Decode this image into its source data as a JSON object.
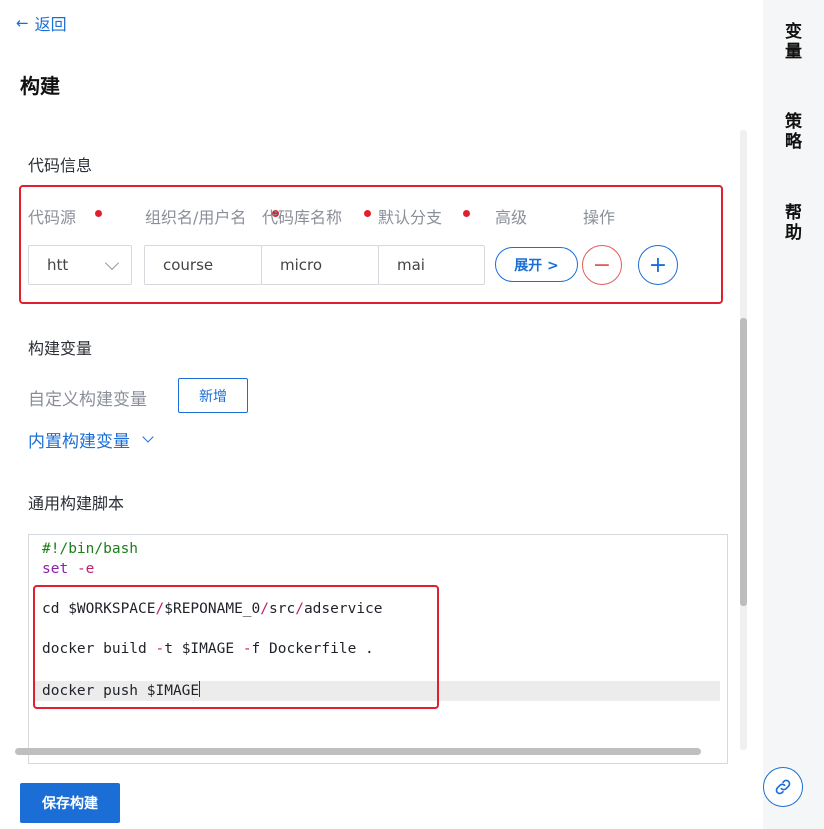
{
  "nav": {
    "back_label": "返回"
  },
  "page": {
    "title": "构建"
  },
  "code_info": {
    "section_title": "代码信息",
    "headers": {
      "source": "代码源",
      "org": "组织名/用户名",
      "repo": "代码库名称",
      "branch": "默认分支",
      "advanced": "高级",
      "actions": "操作"
    },
    "row": {
      "source": "htt",
      "org": "course",
      "repo": "micro",
      "branch": "mai"
    },
    "expand_label": "展开 >",
    "remove_icon": "−",
    "add_icon": "+"
  },
  "build_vars": {
    "section_title": "构建变量",
    "custom_label": "自定义构建变量",
    "add_label": "新增",
    "builtin_label": "内置构建变量"
  },
  "script": {
    "section_title": "通用构建脚本",
    "lines": {
      "l1": "#!/bin/bash",
      "l2_kw": "set",
      "l2_flag": "-e",
      "l3_cmd": "cd $WORKSPACE",
      "l3_mid": "$REPONAME_0",
      "l3_src": "src",
      "l3_end": "adservice",
      "l4_a": "docker build ",
      "l4_b": "-",
      "l4_c": "t $IMAGE ",
      "l4_d": "-",
      "l4_e": "f Dockerfile .",
      "l5": "docker push $IMAGE"
    }
  },
  "save_label": "保存构建",
  "sidebar": {
    "vars": [
      "变",
      "量"
    ],
    "policy": [
      "策",
      "略"
    ],
    "help": [
      "帮",
      "助"
    ]
  },
  "colors": {
    "accent": "#1b6ed6",
    "danger": "#e0202e"
  }
}
